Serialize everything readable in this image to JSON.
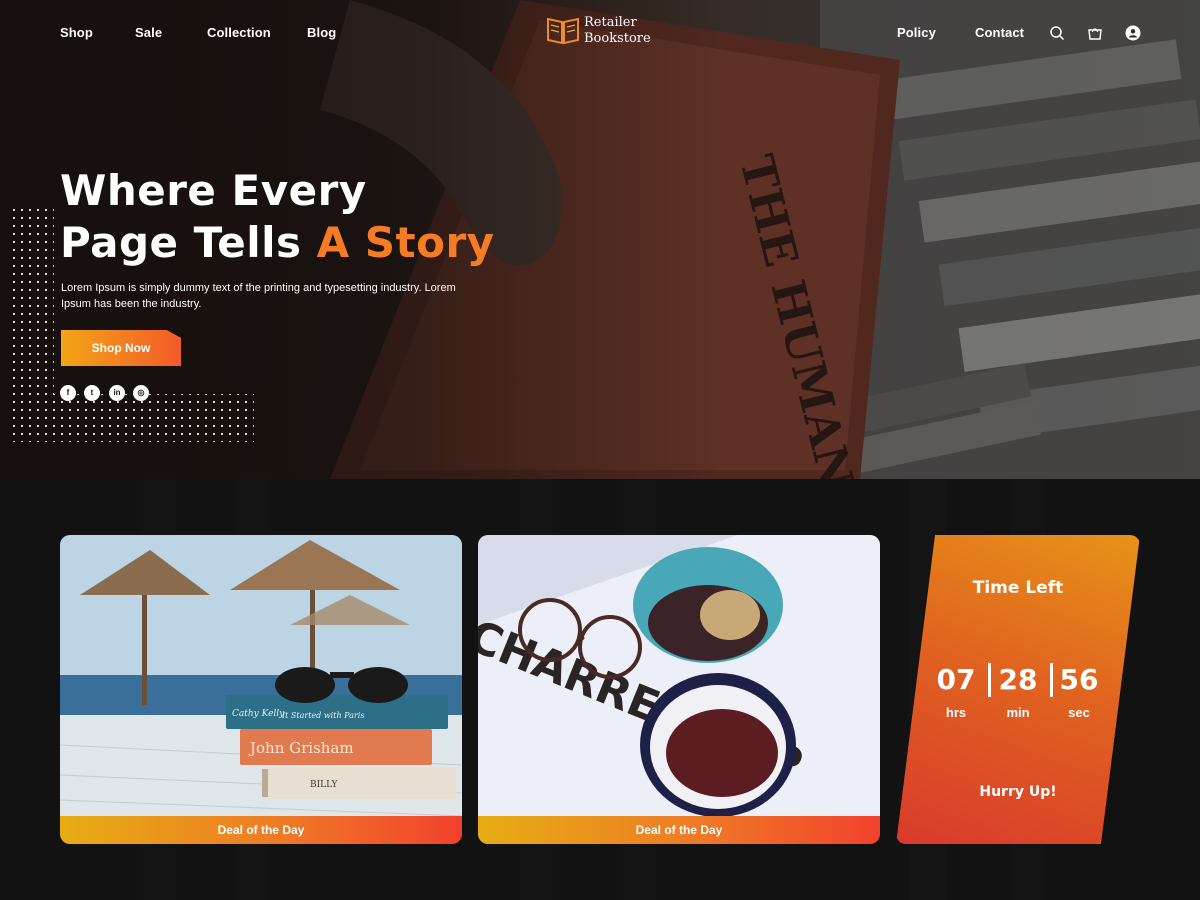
{
  "nav": {
    "left_links": [
      "Shop",
      "Sale",
      "Collection",
      "Blog"
    ],
    "right_links": [
      "Policy",
      "Contact"
    ],
    "logo_line1": "Retailer",
    "logo_line2": "Bookstore",
    "icons": [
      "search-icon",
      "cart-icon",
      "user-icon"
    ]
  },
  "hero": {
    "title_line1": "Where Every",
    "title_line2_start": "Page Tells ",
    "title_line2_accent": "A Story",
    "description": "Lorem Ipsum is simply dummy text of the printing and typesetting industry. Lorem Ipsum has been the industry.",
    "button_label": "Shop Now",
    "socials": [
      "facebook-icon",
      "twitter-icon",
      "linkedin-icon",
      "instagram-icon"
    ],
    "book_text": "THE HUMAN ZOO"
  },
  "deals": {
    "card1_label": "Deal of the Day",
    "card2_label": "Deal of the Day",
    "card1_books": [
      "Cathy Kelly",
      "It Started with Paris",
      "John Grisham"
    ],
    "card2_magazine": "CHARRE CHOP"
  },
  "timer": {
    "title": "Time Left",
    "hours": "07",
    "minutes": "28",
    "seconds": "56",
    "hours_unit": "hrs",
    "minutes_unit": "min",
    "seconds_unit": "sec",
    "cta": "Hurry Up!"
  },
  "colors": {
    "accent": "#f57c25",
    "background": "#121212",
    "gradient_start": "#f3a516",
    "gradient_end": "#f2412d"
  }
}
